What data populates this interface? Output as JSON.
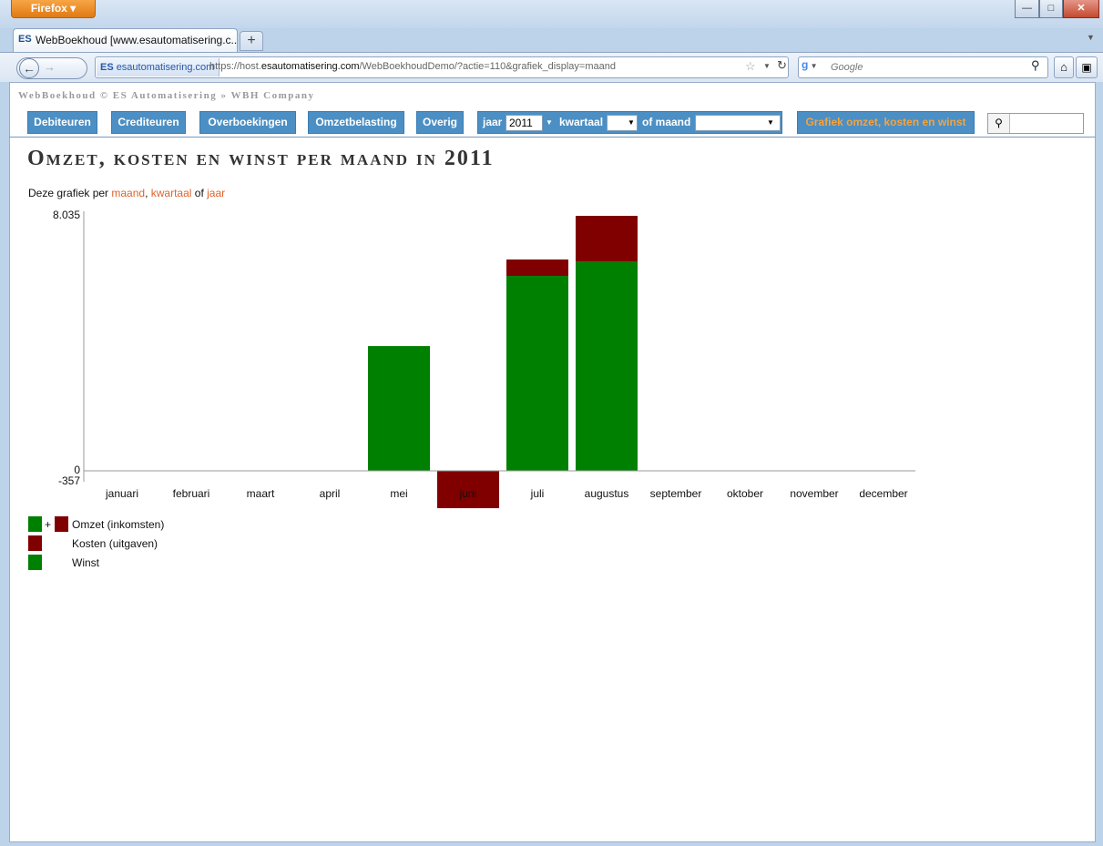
{
  "browser": {
    "app_button": "Firefox",
    "tab_title": "WebBoekhoud [www.esautomatisering.c...",
    "tab_icon": "ES",
    "new_tab_label": "+",
    "identity_label": "esautomatisering.com",
    "url_prefix": "https://host.",
    "url_domain": "esautomatisering.com",
    "url_suffix": "/WebBoekhoudDemo/?actie=110&grafiek_display=maand",
    "search_placeholder": "Google",
    "icons": [
      "back-arrow-icon",
      "forward-arrow-icon",
      "star-icon",
      "reload-icon",
      "google-icon",
      "search-icon",
      "home-icon",
      "bookmarks-icon",
      "minimize-icon",
      "maximize-icon",
      "close-icon"
    ]
  },
  "header": {
    "breadcrumb": "WebBoekhoud © ES Automatisering » WBH Company"
  },
  "menu": {
    "items": [
      "Debiteuren",
      "Crediteuren",
      "Overboekingen",
      "Omzetbelasting",
      "Overig"
    ],
    "filter": {
      "year_label": "jaar",
      "year_value": "2011",
      "quarter_label": "kwartaal",
      "quarter_value": "",
      "month_label": "of maand",
      "month_value": ""
    },
    "chart_button": "Grafiek omzet, kosten en winst"
  },
  "page": {
    "title": "Omzet, kosten en winst per maand in 2011",
    "intro_prefix": "Deze grafiek per ",
    "link_month": "maand",
    "comma": ", ",
    "link_quarter": "kwartaal",
    "of_text": " of ",
    "link_year": "jaar"
  },
  "legend": {
    "plus": "+",
    "omzet": "Omzet (inkomsten)",
    "kosten": "Kosten (uitgaven)",
    "winst": "Winst"
  },
  "colors": {
    "winst": "#008000",
    "kosten": "#800000",
    "menu_bg": "#4b8fc4",
    "link": "#e0622a",
    "chart_button_text": "#f5a340"
  },
  "chart_data": {
    "type": "bar",
    "stacked": true,
    "categories": [
      "januari",
      "februari",
      "maart",
      "april",
      "mei",
      "juni",
      "juli",
      "augustus",
      "september",
      "oktober",
      "november",
      "december"
    ],
    "series": [
      {
        "name": "Winst",
        "values": [
          0,
          0,
          0,
          0,
          3930,
          -357,
          6140,
          6590,
          0,
          0,
          0,
          0
        ]
      },
      {
        "name": "Kosten (uitgaven)",
        "values": [
          0,
          0,
          0,
          0,
          0,
          0,
          520,
          1445,
          0,
          0,
          0,
          0
        ]
      }
    ],
    "ytick_labels": [
      "8.035",
      "0",
      "-357"
    ],
    "ylim": [
      -357,
      8035
    ],
    "legend_position": "bottom-left"
  }
}
